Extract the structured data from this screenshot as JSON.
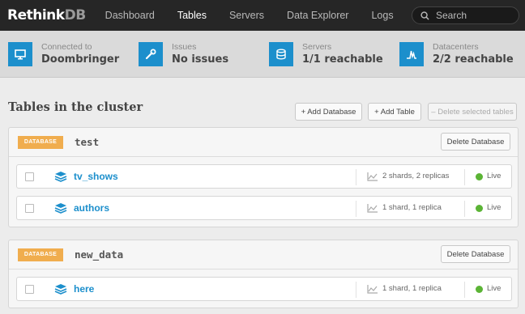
{
  "app": {
    "logo_main": "Rethink",
    "logo_accent": "DB"
  },
  "nav": {
    "items": [
      {
        "label": "Dashboard",
        "active": false
      },
      {
        "label": "Tables",
        "active": true
      },
      {
        "label": "Servers",
        "active": false
      },
      {
        "label": "Data Explorer",
        "active": false
      },
      {
        "label": "Logs",
        "active": false
      }
    ],
    "search_placeholder": "Search"
  },
  "stats": [
    {
      "label": "Connected to",
      "value": "Doombringer",
      "icon": "monitor-icon"
    },
    {
      "label": "Issues",
      "value": "No issues",
      "icon": "wrench-icon"
    },
    {
      "label": "Servers",
      "value": "1/1 reachable",
      "icon": "database-icon"
    },
    {
      "label": "Datacenters",
      "value": "2/2 reachable",
      "icon": "signal-icon"
    }
  ],
  "heading": "Tables in the cluster",
  "actions": {
    "add_database": "+ Add Database",
    "add_table": "+ Add Table",
    "delete_selected": "– Delete selected tables"
  },
  "databases": [
    {
      "badge": "DATABASE",
      "name": "test",
      "delete_label": "Delete Database",
      "tables": [
        {
          "name": "tv_shows",
          "shards": "2 shards, 2 replicas",
          "status": "Live"
        },
        {
          "name": "authors",
          "shards": "1 shard, 1 replica",
          "status": "Live"
        }
      ]
    },
    {
      "badge": "DATABASE",
      "name": "new_data",
      "delete_label": "Delete Database",
      "tables": [
        {
          "name": "here",
          "shards": "1 shard, 1 replica",
          "status": "Live"
        }
      ]
    }
  ],
  "colors": {
    "accent": "#1c8fcc",
    "badge": "#f0ad4e",
    "live": "#5bb435",
    "nav_bg": "#262626"
  }
}
